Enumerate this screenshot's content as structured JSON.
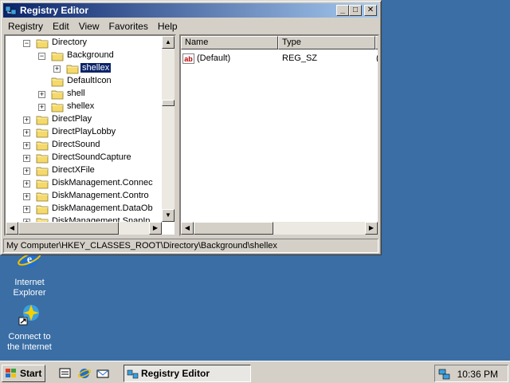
{
  "desktop": {
    "icons": [
      {
        "label_line1": "Internet",
        "label_line2": "Explorer",
        "icon": "internet-explorer-icon"
      },
      {
        "label_line1": "Connect to",
        "label_line2": "the Internet",
        "icon": "connect-internet-icon"
      }
    ],
    "background_color": "#3a6ea5"
  },
  "window": {
    "title": "Registry Editor",
    "title_icon": "registry-editor-icon",
    "buttons": {
      "minimize": "_",
      "maximize": "□",
      "close": "✕"
    },
    "menu": [
      "Registry",
      "Edit",
      "View",
      "Favorites",
      "Help"
    ],
    "tree": {
      "items": [
        {
          "label": "Directory",
          "expander": "−"
        },
        {
          "label": "Background",
          "expander": "−"
        },
        {
          "label": "shellex",
          "expander": "+",
          "selected": true
        },
        {
          "label": "DefaultIcon",
          "expander": ""
        },
        {
          "label": "shell",
          "expander": "+"
        },
        {
          "label": "shellex",
          "expander": "+"
        },
        {
          "label": "DirectPlay",
          "expander": "+"
        },
        {
          "label": "DirectPlayLobby",
          "expander": "+"
        },
        {
          "label": "DirectSound",
          "expander": "+"
        },
        {
          "label": "DirectSoundCapture",
          "expander": "+"
        },
        {
          "label": "DirectXFile",
          "expander": "+"
        },
        {
          "label": "DiskManagement.Connec",
          "expander": "+"
        },
        {
          "label": "DiskManagement.Contro",
          "expander": "+"
        },
        {
          "label": "DiskManagement.DataOb",
          "expander": "+"
        },
        {
          "label": "DiskManagement.SnapIn",
          "expander": "+"
        }
      ]
    },
    "list": {
      "columns": [
        "Name",
        "Type",
        "D"
      ],
      "rows": [
        {
          "name": "(Default)",
          "type": "REG_SZ",
          "data": "("
        }
      ]
    },
    "status": "My Computer\\HKEY_CLASSES_ROOT\\Directory\\Background\\shellex"
  },
  "taskbar": {
    "start_label": "Start",
    "quick_launch": [
      "show-desktop-icon",
      "internet-explorer-icon",
      "outlook-express-icon"
    ],
    "task_button": "Registry Editor",
    "clock": "10:36 PM"
  }
}
